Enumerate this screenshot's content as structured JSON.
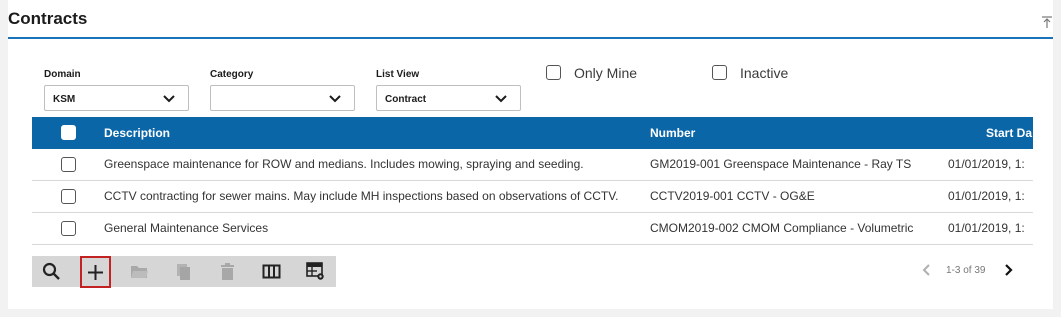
{
  "header": {
    "title": "Contracts"
  },
  "filters": {
    "domain": {
      "label": "Domain",
      "value": "KSM"
    },
    "category": {
      "label": "Category",
      "value": ""
    },
    "list_view": {
      "label": "List View",
      "value": "Contract"
    },
    "only_mine": {
      "label": "Only Mine",
      "checked": false
    },
    "inactive": {
      "label": "Inactive",
      "checked": false
    }
  },
  "grid": {
    "columns": [
      "Description",
      "Number",
      "Start Da"
    ],
    "rows": [
      {
        "description": "Greenspace maintenance for ROW and medians. Includes mowing, spraying and seeding.",
        "number": "GM2019-001 Greenspace Maintenance - Ray TS",
        "start": "01/01/2019, 1:"
      },
      {
        "description": "CCTV contracting for sewer mains. May include MH inspections based on observations of CCTV.",
        "number": "CCTV2019-001 CCTV - OG&E",
        "start": "01/01/2019, 1:"
      },
      {
        "description": "General Maintenance Services",
        "number": "CMOM2019-002 CMOM Compliance - Volumetric",
        "start": "01/01/2019, 1:"
      }
    ]
  },
  "toolbar": {
    "buttons": [
      "search-icon",
      "add-icon",
      "open-folder-icon",
      "copy-icon",
      "delete-icon",
      "columns-icon",
      "grid-settings-icon"
    ]
  },
  "pagination": {
    "info": "1-3 of 39"
  },
  "colors": {
    "accent": "#0b66a8",
    "rule": "#1a73b8",
    "highlight_border": "#c22222"
  }
}
